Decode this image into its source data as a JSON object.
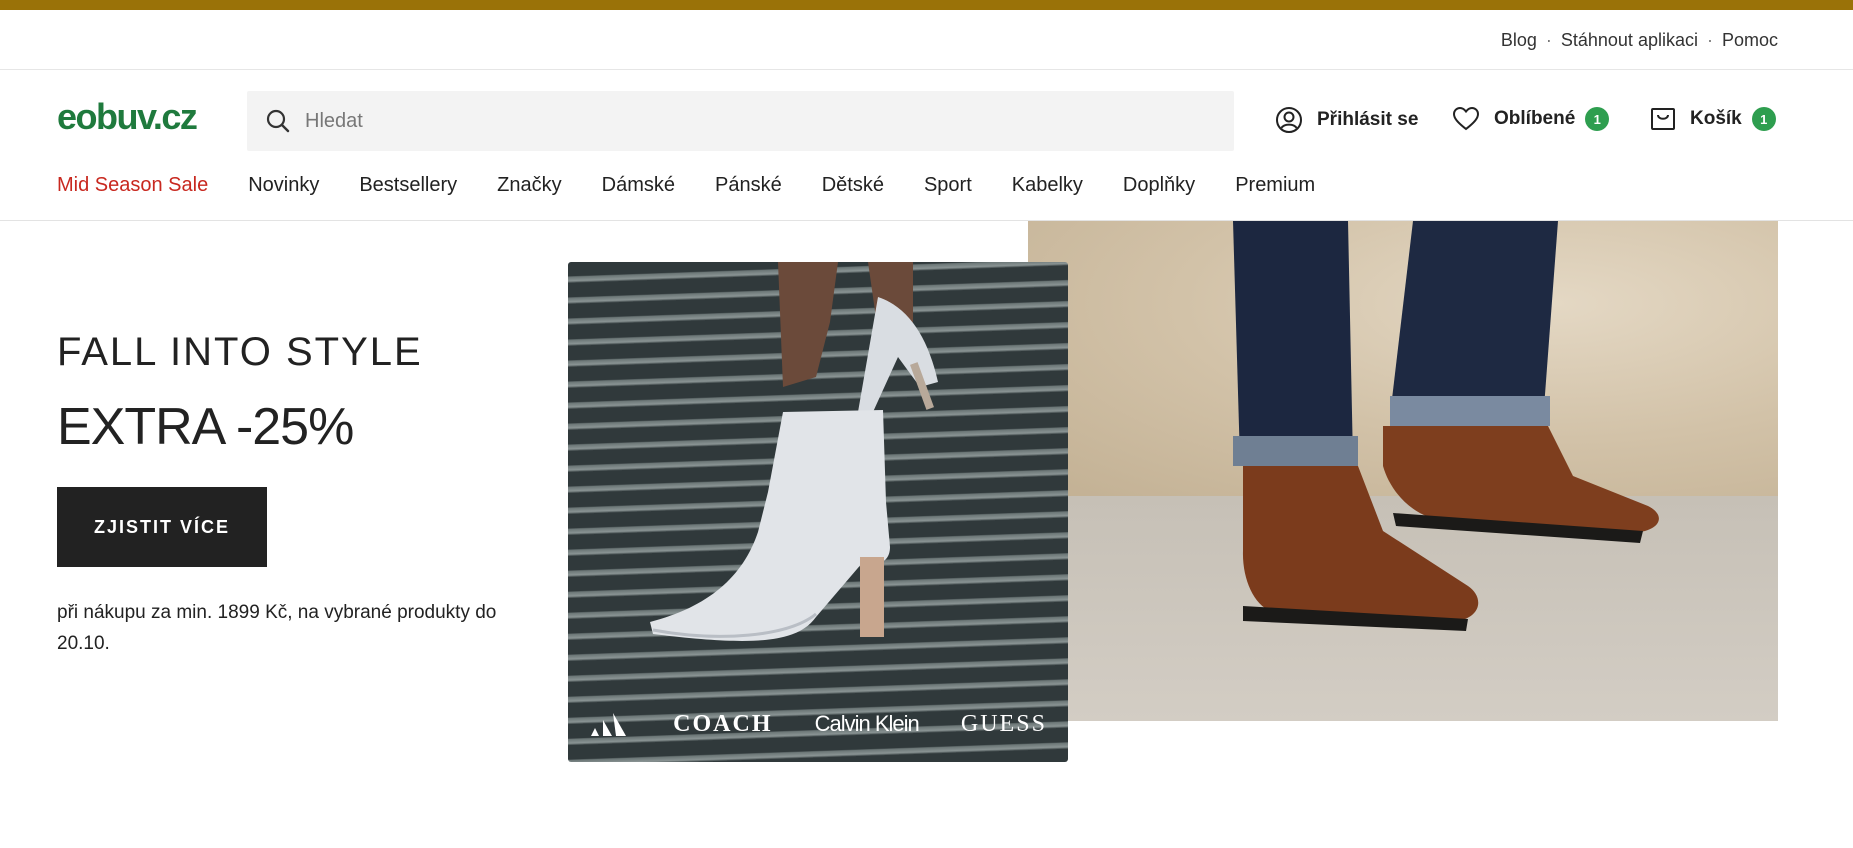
{
  "util_links": [
    "Blog",
    "Stáhnout aplikaci",
    "Pomoc"
  ],
  "util_separator": "·",
  "logo": {
    "main": "eobuv",
    "suffix": ".cz"
  },
  "search": {
    "placeholder": "Hledat"
  },
  "account": {
    "login_label": "Přihlásit se",
    "favorites_label": "Oblíbené",
    "favorites_count": "1",
    "cart_label": "Košík",
    "cart_count": "1"
  },
  "nav": [
    "Mid Season Sale",
    "Novinky",
    "Bestsellery",
    "Značky",
    "Dámské",
    "Pánské",
    "Dětské",
    "Sport",
    "Kabelky",
    "Doplňky",
    "Premium"
  ],
  "hero": {
    "kicker": "FALL INTO STYLE",
    "headline": "EXTRA -25%",
    "cta_label": "ZJISTIT VÍCE",
    "fine_print": "při nákupu za min. 1899 Kč, na vybrané produkty do 20.10."
  },
  "brands": [
    "COACH",
    "Calvin Klein",
    "GUESS"
  ],
  "colors": {
    "accent_bar": "#9a7208",
    "brand_green": "#1f7a3d",
    "sale_red": "#c8281f",
    "badge_green": "#2e9e4f",
    "cta_bg": "#222222"
  },
  "icons": [
    "search-icon",
    "user-icon",
    "heart-icon",
    "cart-icon",
    "adidas-logo"
  ]
}
